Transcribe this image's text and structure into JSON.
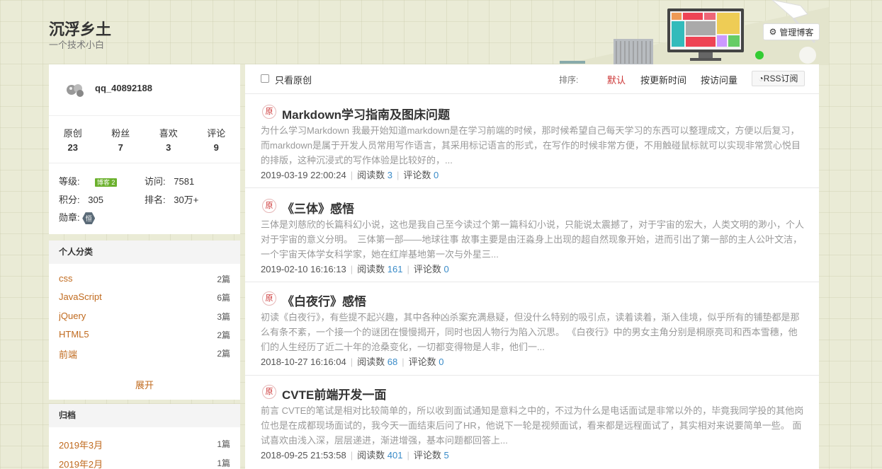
{
  "header": {
    "title": "沉浮乡土",
    "subtitle": "一个技术小白",
    "manage_label": "管理博客"
  },
  "profile": {
    "username": "qq_40892188",
    "stats": [
      {
        "label": "原创",
        "value": "23"
      },
      {
        "label": "粉丝",
        "value": "7"
      },
      {
        "label": "喜欢",
        "value": "3"
      },
      {
        "label": "评论",
        "value": "9"
      }
    ],
    "level_label": "等级:",
    "level_badge": "博客 2",
    "visits_label": "访问:",
    "visits": "7581",
    "points_label": "积分:",
    "points": "305",
    "rank_label": "排名:",
    "rank": "30万+",
    "medal_label": "勋章:",
    "medal_text": "恒"
  },
  "categories": {
    "title": "个人分类",
    "items": [
      {
        "name": "css",
        "count": "2篇"
      },
      {
        "name": "JavaScript",
        "count": "6篇"
      },
      {
        "name": "jQuery",
        "count": "3篇"
      },
      {
        "name": "HTML5",
        "count": "2篇"
      },
      {
        "name": "前端",
        "count": "2篇"
      }
    ],
    "expand_label": "展开"
  },
  "archive": {
    "title": "归档",
    "items": [
      {
        "name": "2019年3月",
        "count": "1篇"
      },
      {
        "name": "2019年2月",
        "count": "1篇"
      }
    ]
  },
  "toolbar": {
    "only_original": "只看原创",
    "sort_label": "排序:",
    "sort_default": "默认",
    "sort_time": "按更新时间",
    "sort_views": "按访问量",
    "rss": "RSS订阅"
  },
  "articles": [
    {
      "tag": "原",
      "title": "Markdown学习指南及图床问题",
      "desc": "为什么学习Markdown 我最开始知道markdown是在学习前端的时候，那时候希望自己每天学习的东西可以整理成文，方便以后复习，而markdown是属于开发人员常用写作语言，其采用标记语言的形式，在写作的时候非常方便，不用触碰鼠标就可以实现非常赏心悦目的排版，这种沉浸式的写作体验是比较好的，...",
      "date": "2019-03-19 22:00:24",
      "reads_label": "阅读数",
      "reads": "3",
      "comments_label": "评论数",
      "comments": "0"
    },
    {
      "tag": "原",
      "title": "《三体》感悟",
      "desc": "三体是刘慈欣的长篇科幻小说，这也是我自己至今读过个第一篇科幻小说，只能说太震撼了，对于宇宙的宏大，人类文明的渺小，个人对于宇宙的意义分明。　三体第一部——地球往事 故事主要是由汪淼身上出现的超自然现象开始，进而引出了第一部的主人公叶文洁，一个宇宙天体学女科学家，她在红岸基地第一次与外星三...",
      "date": "2019-02-10 16:16:13",
      "reads_label": "阅读数",
      "reads": "161",
      "comments_label": "评论数",
      "comments": "0"
    },
    {
      "tag": "原",
      "title": "《白夜行》感悟",
      "desc": "初读《白夜行》，有些提不起兴趣，其中各种凶杀案充满悬疑，但没什么特别的吸引点，读着读着，渐入佳境，似乎所有的铺垫都是那么有条不紊，一个接一个的谜团在慢慢揭开，同时也因人物行为陷入沉思。 《白夜行》中的男女主角分别是桐原亮司和西本雪穗，他们的人生经历了近二十年的沧桑变化，一切都变得物是人非，他们一...",
      "date": "2018-10-27 16:16:04",
      "reads_label": "阅读数",
      "reads": "68",
      "comments_label": "评论数",
      "comments": "0"
    },
    {
      "tag": "原",
      "title": "CVTE前端开发一面",
      "desc": "前言 CVTE的笔试是相对比较简单的，所以收到面试通知是意料之中的，不过为什么是电话面试是非常以外的，毕竟我同学投的其他岗位也是在成都现场面试的，我今天一面结束后问了HR，他说下一轮是视频面试，看来都是远程面试了，其实相对来说要简单一些。 面试喜欢由浅入深，层层递进，渐进增强，基本问题都回答上...",
      "date": "2018-09-25 21:53:58",
      "reads_label": "阅读数",
      "reads": "401",
      "comments_label": "评论数",
      "comments": "5"
    }
  ]
}
